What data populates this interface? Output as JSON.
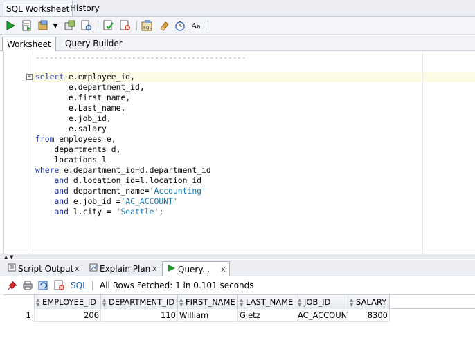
{
  "top_tabs": [
    {
      "label": "SQL Worksheet",
      "active": true
    },
    {
      "label": "History",
      "active": false
    }
  ],
  "toolbar": {
    "icons": [
      "run-statement-icon",
      "run-script-icon",
      "commit-icon",
      "rollback-icon",
      "dropdown-icon",
      "autotrace-icon",
      "explain-plan-icon",
      "sql-tuning-icon",
      "eraser-icon",
      "history-icon",
      "format-icon"
    ]
  },
  "sub_tabs": [
    {
      "label": "Worksheet",
      "active": true
    },
    {
      "label": "Query Builder",
      "active": false
    }
  ],
  "editor": {
    "separator": "----------------------------------------------",
    "lines": [
      [
        {
          "t": "select",
          "c": "kw"
        },
        {
          "t": " e.employee_id,",
          "c": ""
        }
      ],
      [
        {
          "t": "       e.department_id,",
          "c": ""
        }
      ],
      [
        {
          "t": "       e.first_name,",
          "c": ""
        }
      ],
      [
        {
          "t": "       e.Last_name,",
          "c": ""
        }
      ],
      [
        {
          "t": "       e.job_id,",
          "c": ""
        }
      ],
      [
        {
          "t": "       e.salary",
          "c": ""
        }
      ],
      [
        {
          "t": "from",
          "c": "kw"
        },
        {
          "t": " employees e,",
          "c": ""
        }
      ],
      [
        {
          "t": "    departments d,",
          "c": ""
        }
      ],
      [
        {
          "t": "    locations l",
          "c": ""
        }
      ],
      [
        {
          "t": "where",
          "c": "kw"
        },
        {
          "t": " e.department_id=d.department_id",
          "c": ""
        }
      ],
      [
        {
          "t": "    ",
          "c": ""
        },
        {
          "t": "and",
          "c": "kw"
        },
        {
          "t": " d.location_id=l.location_id",
          "c": ""
        }
      ],
      [
        {
          "t": "    ",
          "c": ""
        },
        {
          "t": "and",
          "c": "kw"
        },
        {
          "t": " department_name=",
          "c": ""
        },
        {
          "t": "'Accounting'",
          "c": "str"
        }
      ],
      [
        {
          "t": "    ",
          "c": ""
        },
        {
          "t": "and",
          "c": "kw"
        },
        {
          "t": " e.job_id =",
          "c": ""
        },
        {
          "t": "'AC_ACCOUNT'",
          "c": "str"
        }
      ],
      [
        {
          "t": "    ",
          "c": ""
        },
        {
          "t": "and",
          "c": "kw"
        },
        {
          "t": " l.city = ",
          "c": ""
        },
        {
          "t": "'Seattle'",
          "c": "str"
        },
        {
          "t": ";",
          "c": ""
        }
      ]
    ]
  },
  "output_tabs": [
    {
      "label": "Script Output",
      "icon": "script-output-icon",
      "active": false
    },
    {
      "label": "Explain Plan",
      "icon": "explain-plan-icon",
      "active": false
    },
    {
      "label": "Query...",
      "icon": "query-result-icon",
      "active": true
    }
  ],
  "output_toolbar": {
    "sql_label": "SQL",
    "status": "All Rows Fetched: 1 in 0.101 seconds"
  },
  "grid": {
    "columns": [
      "EMPLOYEE_ID",
      "DEPARTMENT_ID",
      "FIRST_NAME",
      "LAST_NAME",
      "JOB_ID",
      "SALARY"
    ],
    "rows": [
      {
        "num": "1",
        "cells": [
          "206",
          "110",
          "William",
          "Gietz",
          "AC_ACCOUNT",
          "8300"
        ]
      }
    ]
  },
  "colors": {
    "keyword": "#1a2fa8",
    "string": "#1a7ab0",
    "run": "#1e9a2e"
  }
}
